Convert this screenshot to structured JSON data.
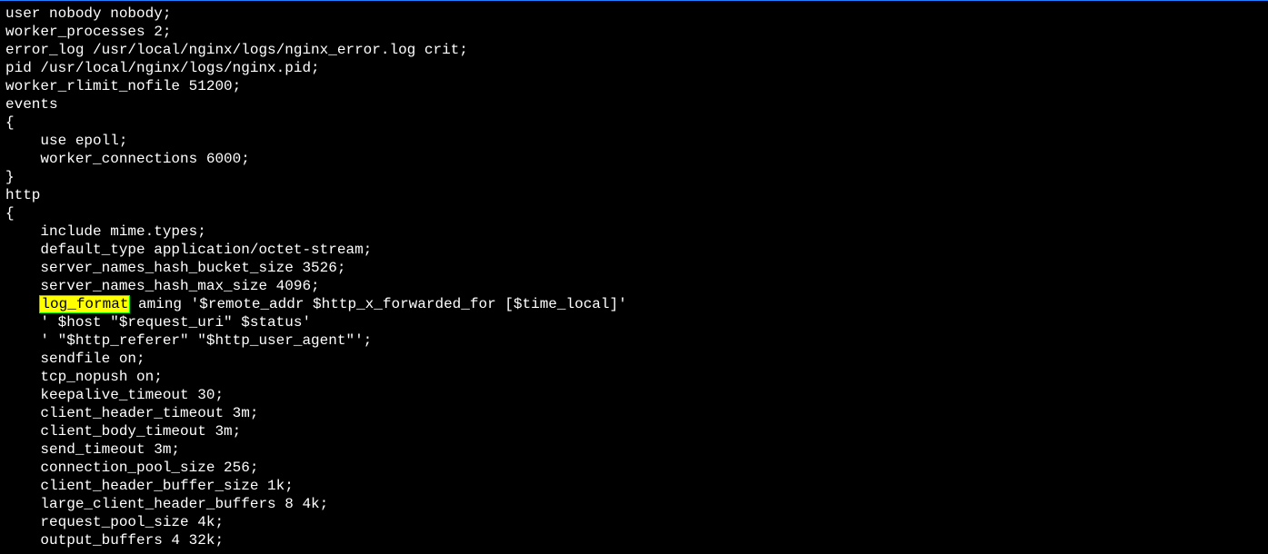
{
  "terminal": {
    "lines": [
      {
        "indent": 0,
        "text": "user nobody nobody;"
      },
      {
        "indent": 0,
        "text": "worker_processes 2;"
      },
      {
        "indent": 0,
        "text": "error_log /usr/local/nginx/logs/nginx_error.log crit;"
      },
      {
        "indent": 0,
        "text": "pid /usr/local/nginx/logs/nginx.pid;"
      },
      {
        "indent": 0,
        "text": "worker_rlimit_nofile 51200;"
      },
      {
        "indent": 0,
        "text": "events"
      },
      {
        "indent": 0,
        "text": "{"
      },
      {
        "indent": 4,
        "text": "use epoll;"
      },
      {
        "indent": 4,
        "text": "worker_connections 6000;"
      },
      {
        "indent": 0,
        "text": "}"
      },
      {
        "indent": 0,
        "text": "http"
      },
      {
        "indent": 0,
        "text": "{"
      },
      {
        "indent": 4,
        "text": "include mime.types;"
      },
      {
        "indent": 4,
        "text": "default_type application/octet-stream;"
      },
      {
        "indent": 4,
        "text": "server_names_hash_bucket_size 3526;"
      },
      {
        "indent": 4,
        "text": "server_names_hash_max_size 4096;"
      },
      {
        "indent": 4,
        "text": "",
        "highlight_prefix": "log_format",
        "suffix": " aming '$remote_addr $http_x_forwarded_for [$time_local]'"
      },
      {
        "indent": 4,
        "text": "' $host \"$request_uri\" $status'"
      },
      {
        "indent": 4,
        "text": "' \"$http_referer\" \"$http_user_agent\"';"
      },
      {
        "indent": 4,
        "text": "sendfile on;"
      },
      {
        "indent": 4,
        "text": "tcp_nopush on;"
      },
      {
        "indent": 4,
        "text": "keepalive_timeout 30;"
      },
      {
        "indent": 4,
        "text": "client_header_timeout 3m;"
      },
      {
        "indent": 4,
        "text": "client_body_timeout 3m;"
      },
      {
        "indent": 4,
        "text": "send_timeout 3m;"
      },
      {
        "indent": 4,
        "text": "connection_pool_size 256;"
      },
      {
        "indent": 4,
        "text": "client_header_buffer_size 1k;"
      },
      {
        "indent": 4,
        "text": "large_client_header_buffers 8 4k;"
      },
      {
        "indent": 4,
        "text": "request_pool_size 4k;"
      },
      {
        "indent": 4,
        "text": "output_buffers 4 32k;"
      }
    ]
  }
}
